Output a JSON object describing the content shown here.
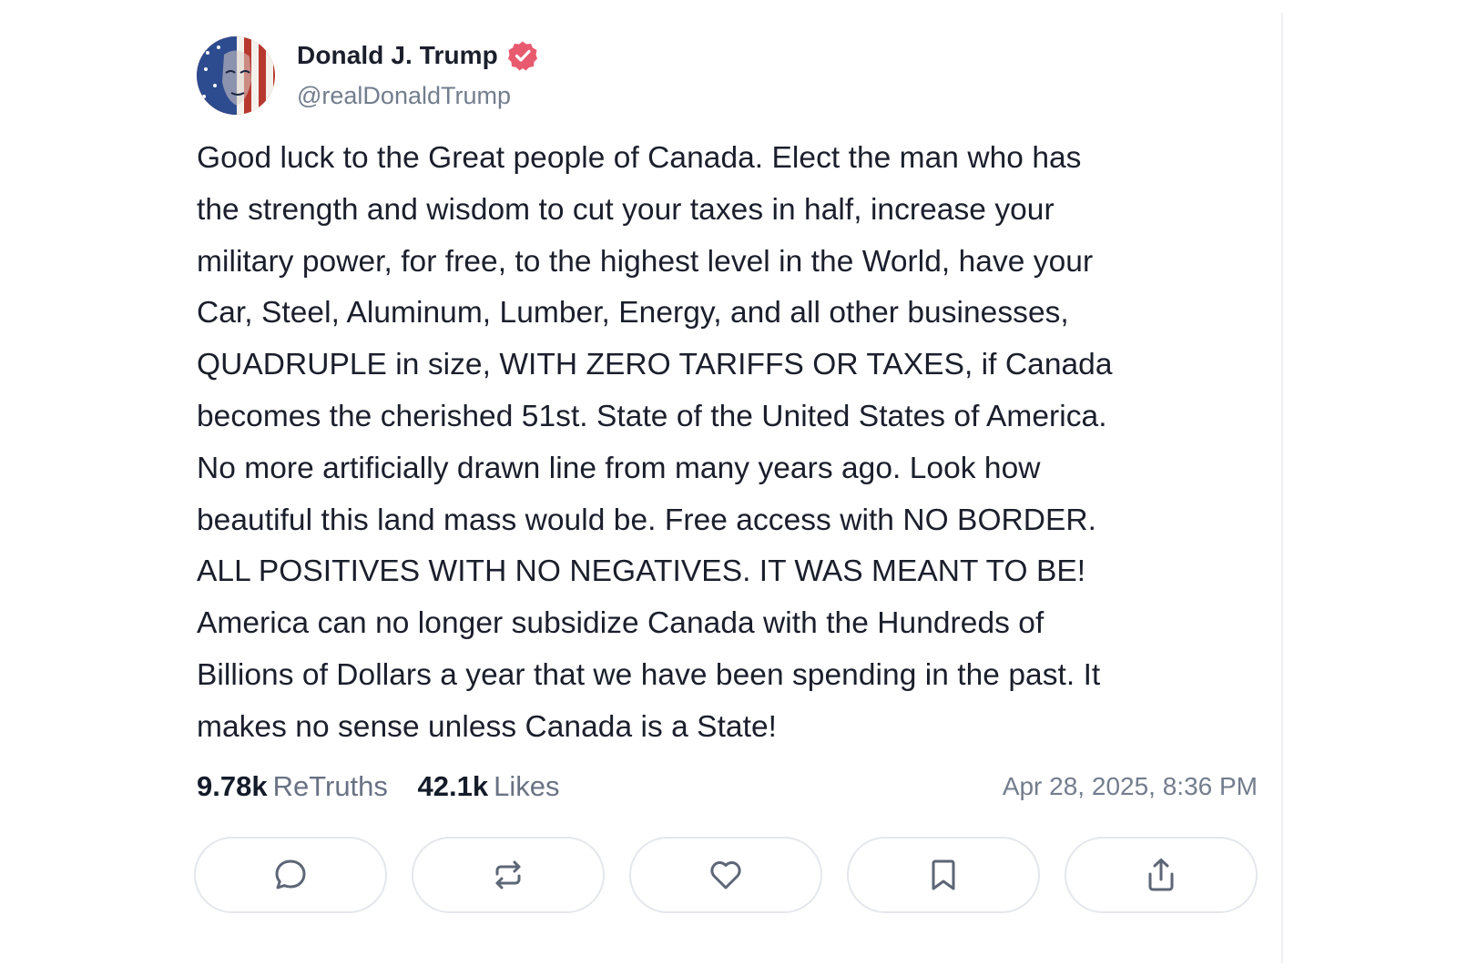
{
  "author": {
    "name": "Donald J. Trump",
    "handle": "@realDonaldTrump",
    "verified": true
  },
  "post": {
    "text": "Good luck to the Great people of Canada. Elect the man who has\nthe strength and wisdom to cut your taxes in half, increase your\nmilitary power, for free, to the highest level in the World, have your\nCar, Steel, Aluminum, Lumber, Energy, and all other businesses,\nQUADRUPLE in size, WITH ZERO TARIFFS OR TAXES, if Canada\nbecomes the cherished 51st. State of the United States of America.\nNo more artificially drawn line from many years ago. Look how\nbeautiful this land mass would be. Free access with NO BORDER.\nALL POSITIVES WITH NO NEGATIVES. IT WAS MEANT TO BE!\nAmerica can no longer subsidize Canada with the Hundreds of\nBillions of Dollars a year that we have been spending in the past. It\nmakes no sense unless Canada is a State!"
  },
  "stats": {
    "retruths_count": "9.78k",
    "retruths_label": "ReTruths",
    "likes_count": "42.1k",
    "likes_label": "Likes",
    "timestamp": "Apr 28, 2025, 8:36 PM"
  },
  "actions": [
    {
      "icon": "reply-icon"
    },
    {
      "icon": "retruth-icon"
    },
    {
      "icon": "heart-icon"
    },
    {
      "icon": "bookmark-icon"
    },
    {
      "icon": "share-icon"
    }
  ],
  "colors": {
    "verified_badge": "#e85a6e",
    "text_primary": "#1b1f2c",
    "text_secondary": "#737d8d",
    "button_border": "#e4e7ec"
  }
}
